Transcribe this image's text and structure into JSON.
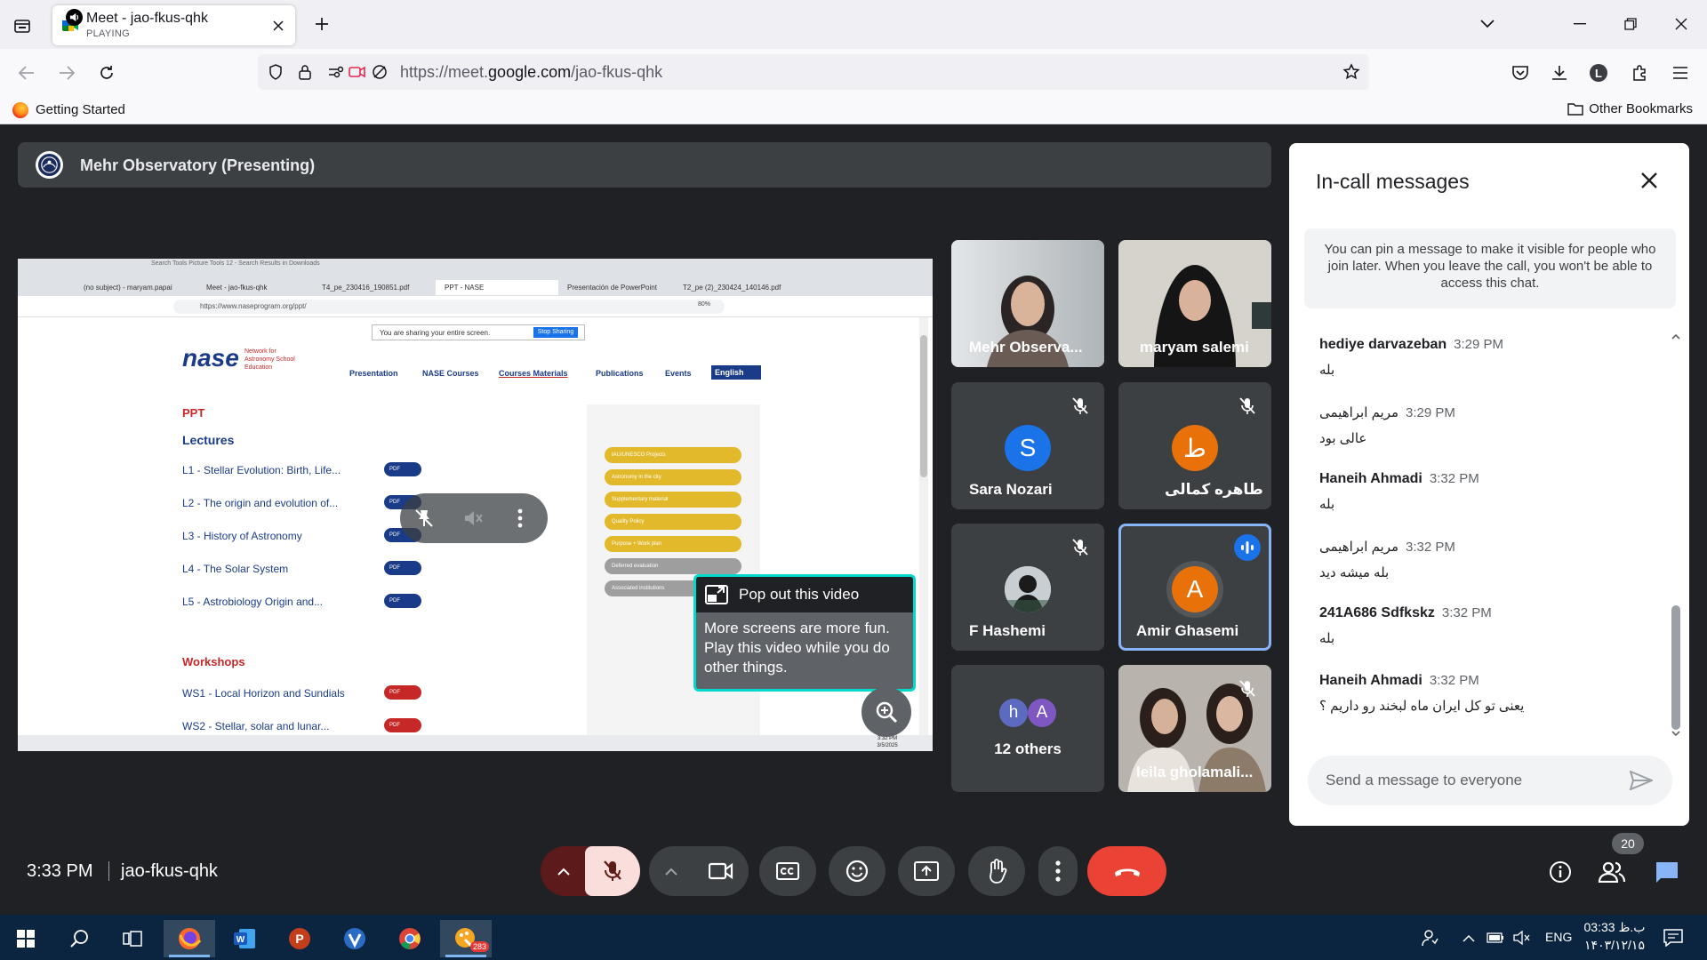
{
  "browser": {
    "tab": {
      "title": "Meet - jao-fkus-qhk",
      "subtitle": "PLAYING"
    },
    "url": {
      "prefix": "https://meet.",
      "domain": "google.com",
      "path": "/jao-fkus-qhk"
    },
    "bookmarks": {
      "getting_started": "Getting Started",
      "other": "Other Bookmarks"
    }
  },
  "meet": {
    "presenting": "Mehr Observatory (Presenting)",
    "shared_screen": {
      "tabs": [
        "(no subject) - maryam.papai",
        "Meet - jao-fkus-qhk",
        "T4_pe_230416_190851.pdf",
        "PPT - NASE",
        "Presentación de PowerPoint",
        "T2_pe (2)_230424_140146.pdf"
      ],
      "window_title_hint": "Search Tools   Picture Tools    12 - Search Results in Downloads",
      "url": "https://www.naseprogram.org/ppt/",
      "zoom": "80%",
      "share_notice": "You are sharing your entire screen.",
      "stop_sharing": "Stop Sharing",
      "nase_logo": "nase",
      "nase_tagline": "Network for Astronomy School Education",
      "menu": [
        "Presentation",
        "NASE Courses",
        "Courses Materials",
        "Publications",
        "Events"
      ],
      "language": "English",
      "ppt_heading": "PPT",
      "lectures_heading": "Lectures",
      "lectures": [
        "L1 - Stellar Evolution: Birth, Life...",
        "L2 - The origin and evolution of...",
        "L3 - History of Astronomy",
        "L4 - The Solar System",
        "L5 - Astrobiology Origin and..."
      ],
      "workshops_heading": "Workshops",
      "workshops": [
        "WS1 - Local Horizon and Sundials",
        "WS2 - Stellar, solar and lunar..."
      ],
      "side_items": [
        "IAU/UNESCO Projects",
        "Astronomy in the city",
        "Supplementary material",
        "Quality Policy",
        "Purpose + Work plan",
        "Deferred evaluation",
        "Associated institutions"
      ],
      "pdf_label": "PDF",
      "taskbar_clock": {
        "time": "3:32 PM",
        "date": "3/5/2025"
      }
    },
    "popout": {
      "title": "Pop out this video",
      "body": "More screens are more fun. Play this video while you do other things."
    },
    "tiles": [
      {
        "name": "Mehr Observa...",
        "muted": false
      },
      {
        "name": "maryam salemi",
        "muted": false
      },
      {
        "name": "Sara Nozari",
        "initial": "S",
        "muted": true,
        "color": "#1a73e8"
      },
      {
        "name": "طاهره کمالی",
        "initial": "ط",
        "muted": true,
        "color": "#e8710a"
      },
      {
        "name": "F Hashemi",
        "muted": true
      },
      {
        "name": "Amir Ghasemi",
        "initial": "A",
        "muted": false,
        "speaking": true,
        "color": "#e8710a"
      },
      {
        "name": "12 others",
        "initials": [
          "h",
          "A"
        ]
      },
      {
        "name": "leila gholamali...",
        "muted": true
      }
    ],
    "chat": {
      "title": "In-call messages",
      "info": "You can pin a message to make it visible for people who join later. When you leave the call, you won't be able to access this chat.",
      "messages": [
        {
          "sender": "hediye darvazeban",
          "time": "3:29 PM",
          "text": "بله"
        },
        {
          "sender": "مریم ابراهیمی",
          "time": "3:29 PM",
          "text": "عالی بود"
        },
        {
          "sender": "Haneih Ahmadi",
          "time": "3:32 PM",
          "text": "بله"
        },
        {
          "sender": "مریم ابراهیمی",
          "time": "3:32 PM",
          "text": "بله میشه دید"
        },
        {
          "sender": "241A686 Sdfkskz",
          "time": "3:32 PM",
          "text": "بله"
        },
        {
          "sender": "Haneih Ahmadi",
          "time": "3:32 PM",
          "text": "یعنی تو کل ایران ماه لبخند رو داریم ؟"
        }
      ],
      "input_placeholder": "Send a message to everyone"
    },
    "bottom": {
      "time": "3:33 PM",
      "code": "jao-fkus-qhk",
      "participants_count": "20"
    }
  },
  "taskbar": {
    "apps": [
      "start-icon",
      "search-icon",
      "task-view-icon",
      "firefox-icon",
      "word-icon",
      "powerpoint-icon",
      "vpn-icon",
      "chrome-icon",
      "paint-icon"
    ],
    "paint_badge": "283",
    "lang": "ENG",
    "time": "03:33 ب.ظ",
    "date": "۱۴۰۳/۱۲/۱۵"
  },
  "colors": {
    "meet_bg": "#202124",
    "tile": "#3c4043",
    "hangup": "#ea4335",
    "accent": "#1a73e8",
    "popout_border": "#00d9cc"
  }
}
